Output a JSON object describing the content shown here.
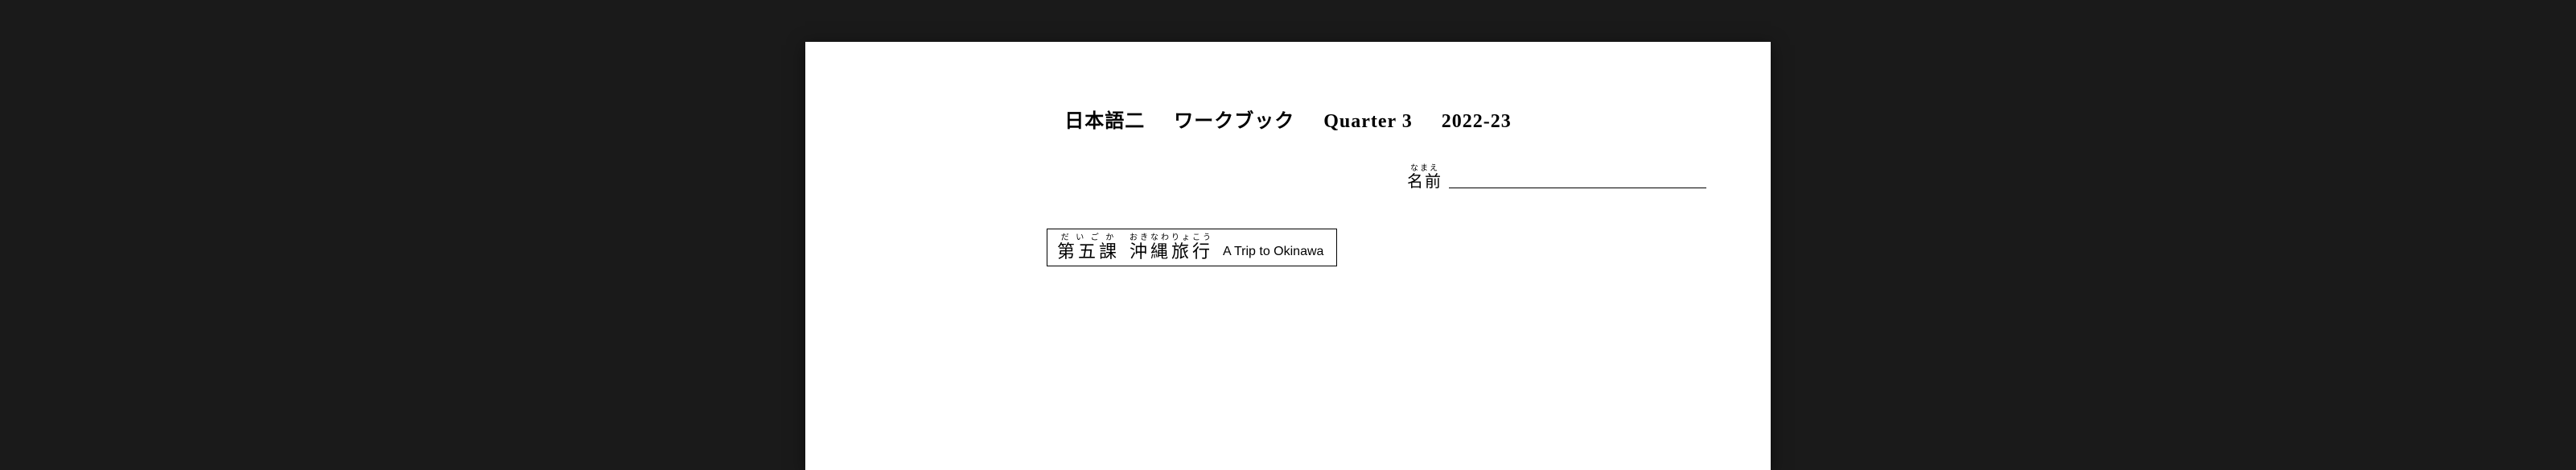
{
  "header": {
    "course": "日本語二",
    "book": "ワークブック",
    "quarter": "Quarter 3",
    "year": "2022-23"
  },
  "name_field": {
    "furigana": "なまえ",
    "kanji": "名前"
  },
  "lesson": {
    "number_furigana": "だ い ご か",
    "number_kanji": "第五課",
    "title_furigana": "おきなわりょこう",
    "title_kanji": "沖縄旅行",
    "subtitle": "A Trip to Okinawa"
  }
}
